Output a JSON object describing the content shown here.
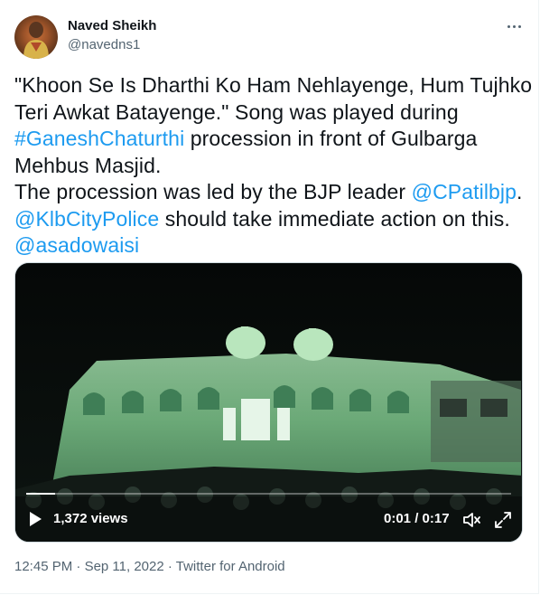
{
  "author": {
    "name": "Naved Sheikh",
    "handle": "@navedns1"
  },
  "tweet": {
    "line1": "\"Khoon Se Is Dharthi Ko Ham Nehlayenge, Hum Tujhko",
    "line2": "Teri Awkat Batayenge.\" Song was played during",
    "hashtag": "#GaneshChaturthi",
    "line3_rest": " procession in front of Gulbarga",
    "line4": "Mehbus Masjid.",
    "line5_start": "The procession was led by the BJP leader ",
    "mention1": "@CPatilbjp",
    "line5_end": ".",
    "mention2": "@KlbCityPolice",
    "line6_rest": " should take immediate action on this.",
    "mention3": "@asadowaisi"
  },
  "video": {
    "views": "1,372 views",
    "time": "0:01 / 0:17",
    "progress": 0.06
  },
  "meta": {
    "time": "12:45 PM",
    "sep1": " · ",
    "date": "Sep 11, 2022",
    "sep2": " · ",
    "source": "Twitter for Android"
  },
  "icons": {
    "more": "more-options-icon",
    "play": "play-icon",
    "mute": "mute-icon",
    "fullscreen": "fullscreen-icon"
  },
  "colors": {
    "link": "#1d9bf0",
    "secondary": "#536471",
    "text": "#0f1419"
  }
}
